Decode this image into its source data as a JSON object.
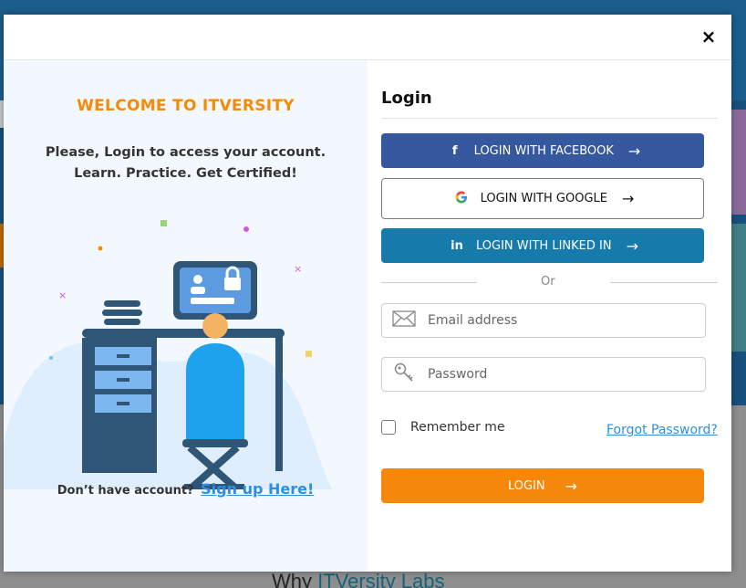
{
  "backdrop": {
    "why_prefix": "Why",
    "why_link": "ITVersity Labs"
  },
  "modal": {
    "close_label": "×",
    "left": {
      "welcome": "WELCOME TO ITVERSITY",
      "line1": "Please, Login to access your account.",
      "line2": "Learn. Practice. Get Certified!",
      "no_account": "Don’t have account?",
      "signup_link": "Sign up Here!"
    },
    "right": {
      "title": "Login",
      "facebook_label": "LOGIN WITH FACEBOOK",
      "google_label": "LOGIN WITH GOOGLE",
      "linkedin_label": "LOGIN WITH LINKED IN",
      "or": "Or",
      "email_placeholder": "Email address",
      "password_placeholder": "Password",
      "remember_label": "Remember me",
      "forgot_label": "Forgot Password?",
      "login_label": "LOGIN",
      "remember_checked": false
    }
  },
  "icons": {
    "close": "close-icon",
    "facebook": "facebook-icon",
    "google": "google-icon",
    "linkedin": "linkedin-icon",
    "arrow": "arrow-right-icon",
    "email": "envelope-icon",
    "password": "key-icon"
  },
  "colors": {
    "accent_orange": "#f5870a",
    "facebook_blue": "#35589e",
    "linkedin_blue": "#167aab",
    "link_blue": "#2e8fe0",
    "left_pane_bg": "#f3f8fe"
  }
}
